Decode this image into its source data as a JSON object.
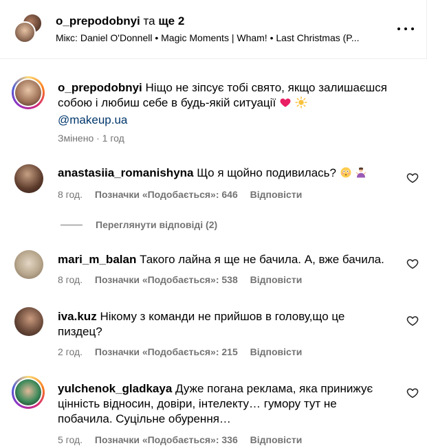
{
  "header": {
    "user": "o_prepodobnyi",
    "connector": "та",
    "others": "ще 2",
    "audio": "Мікс: Daniel O'Donnell • Magic Moments | Wham! • Last Christmas (P..."
  },
  "caption": {
    "username": "o_prepodobnyi",
    "text_line1": "Ніщо не зіпсує тобі свято, якщо залишаєшся",
    "text_line2": "собою і любиш себе в будь-якій ситуації",
    "mention": "@makeup.ua",
    "meta": "Змінено · 1 год"
  },
  "comments": [
    {
      "username": "anastasiia_romanishyna",
      "text": "Що я щойно подивилась?",
      "time": "8 год.",
      "likes": "Позначки «Подобається»: 646",
      "reply": "Відповісти"
    },
    {
      "username": "mari_m_balan",
      "text": "Такого лайна я ще не бачила. А, вже бачила.",
      "time": "8 год.",
      "likes": "Позначки «Подобається»: 538",
      "reply": "Відповісти"
    },
    {
      "username": "iva.kuz",
      "text_line1": "Нікому з команди не прийшов в голову,що це",
      "text_line2": "пиздец?",
      "time": "2 год.",
      "likes": "Позначки «Подобається»: 215",
      "reply": "Відповісти"
    },
    {
      "username": "yulchenok_gladkaya",
      "text_line1": "Дуже погана реклама, яка принижує",
      "text_line2": "цінність відносин, довіри, інтелекту… гумору тут не",
      "text_line3": "побачила. Суцільне обурення…",
      "time": "5 год.",
      "likes": "Позначки «Подобається»: 336",
      "reply": "Відповісти"
    }
  ],
  "view_replies": "Переглянути відповіді (2)",
  "icons": {
    "more": "more-horizontal-icon",
    "like": "heart-outline-icon"
  },
  "colors": {
    "muted": "#737373",
    "link": "#00376b",
    "divider": "#efefef"
  }
}
